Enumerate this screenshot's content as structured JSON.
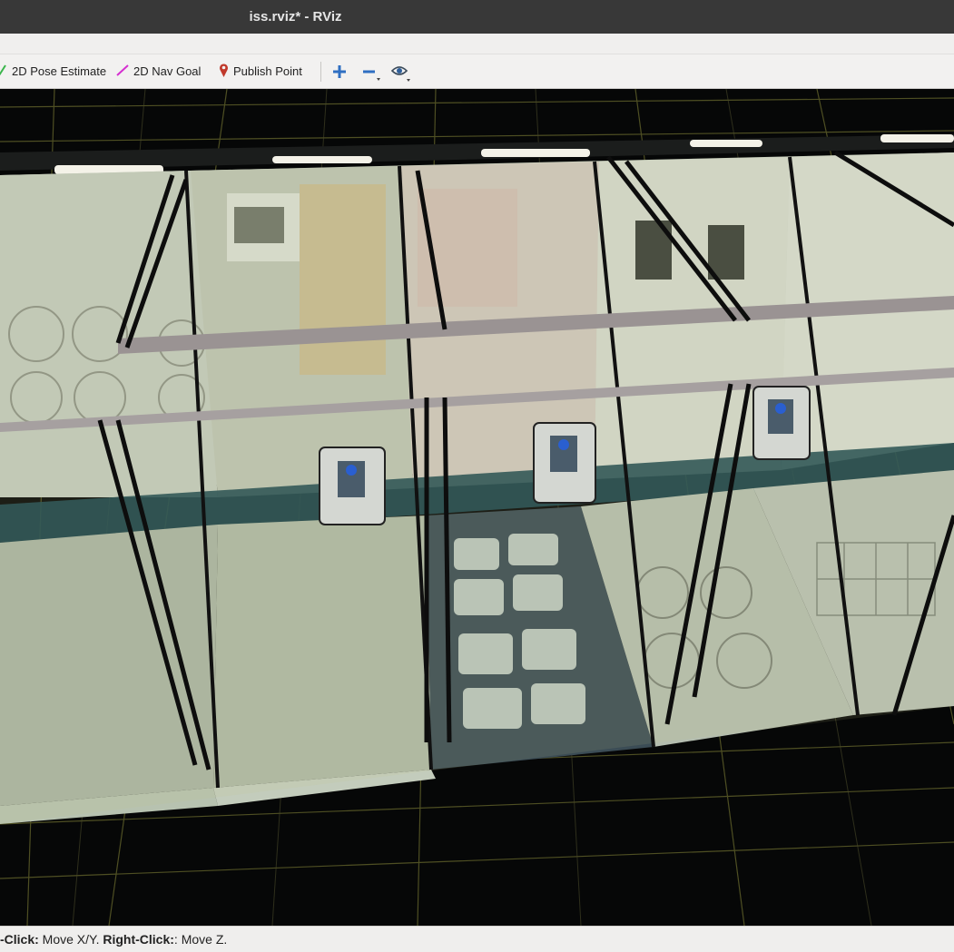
{
  "window": {
    "title": "iss.rviz* - RViz"
  },
  "toolbar": {
    "pose_estimate_label": "2D Pose Estimate",
    "nav_goal_label": "2D Nav Goal",
    "publish_point_label": "Publish Point",
    "icons": [
      "pose-arrow-icon",
      "nav-goal-arrow-icon",
      "map-pin-icon",
      "plus-icon",
      "minus-icon",
      "eye-icon"
    ],
    "colors": {
      "pose_arrow": "#39b54a",
      "nav_goal_arrow": "#d52fd0",
      "map_pin": "#c0392b",
      "plus_minus": "#2f6fc2"
    }
  },
  "status": {
    "left_click_label": "-Click:",
    "left_click_action": " Move X/Y. ",
    "right_click_label": "Right-Click:",
    "right_click_action": ": Move Z."
  },
  "scene": {
    "description_colors": {
      "background": "#060707",
      "grid": "#a8a64a",
      "panels": "#c9d2c4",
      "handrail": "#9b9494"
    }
  }
}
